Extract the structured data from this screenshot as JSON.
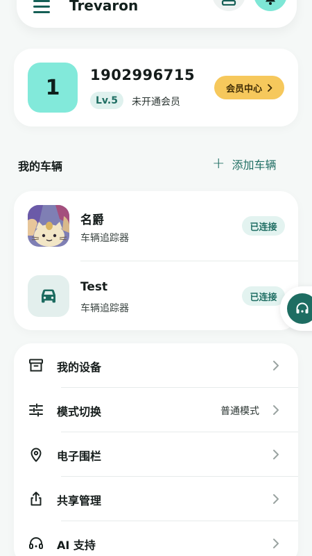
{
  "app": {
    "title": "Trevaron"
  },
  "profile": {
    "avatar_text": "1",
    "phone": "1902996715",
    "level": "Lv.5",
    "member_status": "未开通会员",
    "vip_button": "会员中心"
  },
  "vehicles": {
    "section_title": "我的车辆",
    "add_label": "添加车辆",
    "items": [
      {
        "name": "名爵",
        "type": "车辆追踪器",
        "status": "已连接"
      },
      {
        "name": "Test",
        "type": "车辆追踪器",
        "status": "已连接"
      }
    ]
  },
  "menu": {
    "items": [
      {
        "label": "我的设备",
        "value": ""
      },
      {
        "label": "模式切换",
        "value": "普通模式"
      },
      {
        "label": "电子围栏",
        "value": ""
      },
      {
        "label": "共享管理",
        "value": ""
      },
      {
        "label": "AI 支持",
        "value": ""
      }
    ]
  },
  "colors": {
    "accent": "#1f6e63",
    "avatar_bg": "#82e9da",
    "vip": "#f6c85c",
    "background": "#f5f8f7"
  }
}
